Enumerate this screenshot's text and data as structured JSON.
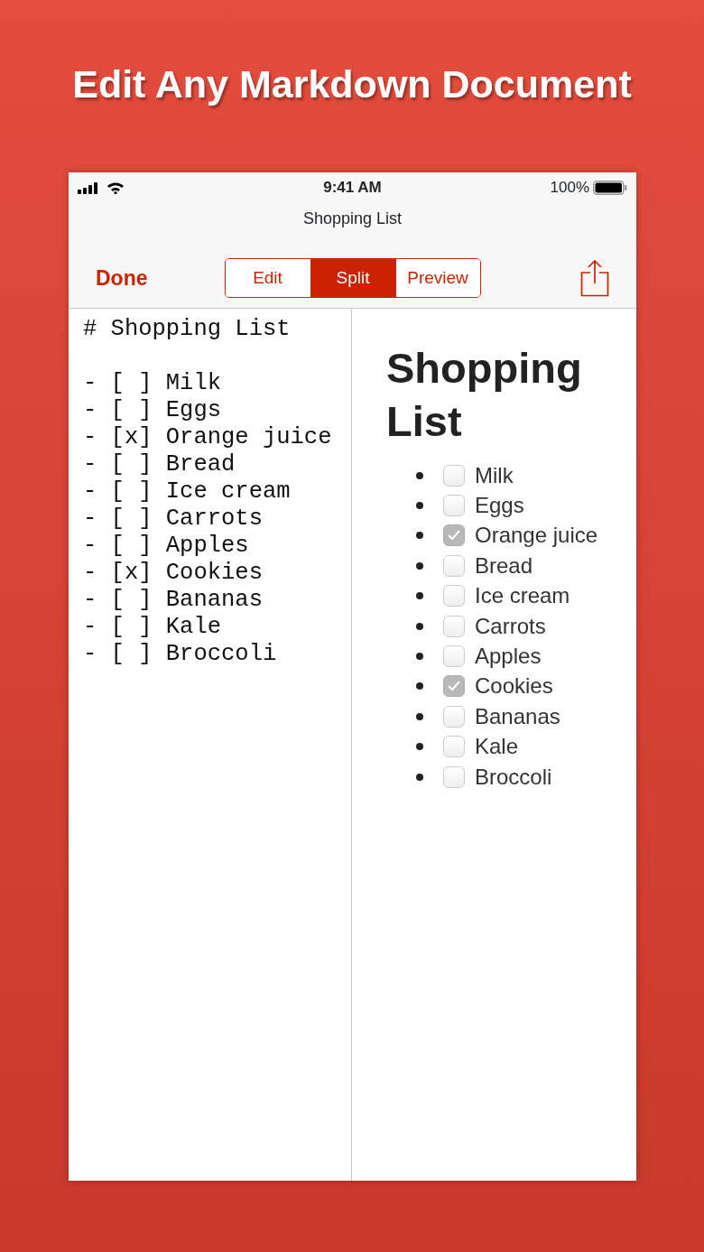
{
  "headline": "Edit Any Markdown Document",
  "status_bar": {
    "time": "9:41 AM",
    "battery": "100%"
  },
  "title": "Shopping List",
  "done": "Done",
  "segments": [
    {
      "label": "Edit",
      "selected": false
    },
    {
      "label": "Split",
      "selected": true
    },
    {
      "label": "Preview",
      "selected": false
    }
  ],
  "source_heading": "# Shopping List",
  "source_lines": [
    "- [ ] Milk",
    "- [ ] Eggs",
    "- [x] Orange juice",
    "- [ ] Bread",
    "- [ ] Ice cream",
    "- [ ] Carrots",
    "- [ ] Apples",
    "- [x] Cookies",
    "- [ ] Bananas",
    "- [ ] Kale",
    "- [ ] Broccoli"
  ],
  "preview": {
    "heading": "Shopping List",
    "items": [
      {
        "label": "Milk",
        "checked": false
      },
      {
        "label": "Eggs",
        "checked": false
      },
      {
        "label": "Orange juice",
        "checked": true
      },
      {
        "label": "Bread",
        "checked": false
      },
      {
        "label": "Ice cream",
        "checked": false
      },
      {
        "label": "Carrots",
        "checked": false
      },
      {
        "label": "Apples",
        "checked": false
      },
      {
        "label": "Cookies",
        "checked": true
      },
      {
        "label": "Bananas",
        "checked": false
      },
      {
        "label": "Kale",
        "checked": false
      },
      {
        "label": "Broccoli",
        "checked": false
      }
    ]
  }
}
